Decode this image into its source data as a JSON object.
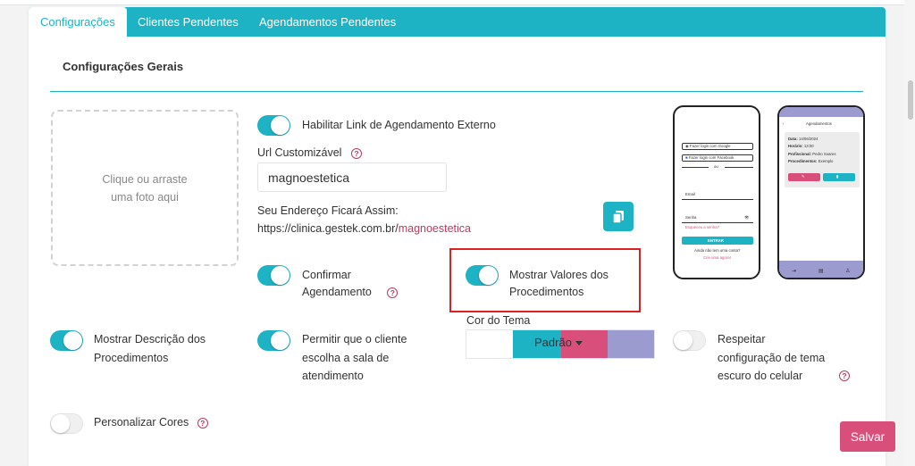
{
  "tabs": [
    {
      "label": "Configurações",
      "active": true
    },
    {
      "label": "Clientes Pendentes",
      "active": false
    },
    {
      "label": "Agendamentos Pendentes",
      "active": false
    }
  ],
  "section": {
    "title": "Configurações Gerais"
  },
  "dropzone": {
    "line1": "Clique ou arraste",
    "line2": "uma foto aqui"
  },
  "settings": {
    "external_link": {
      "label": "Habilitar Link de Agendamento Externo",
      "on": true
    },
    "custom_url": {
      "label": "Url Customizável",
      "value": "magnoestetica"
    },
    "address": {
      "label": "Seu Endereço Ficará Assim:",
      "base": "https://clinica.gestek.com.br/",
      "slug": "magnoestetica"
    },
    "confirm": {
      "line1": "Confirmar",
      "line2": "Agendamento",
      "on": true
    },
    "show_values": {
      "line1": "Mostrar Valores dos",
      "line2": "Procedimentos",
      "on": true
    },
    "show_description": {
      "line1": "Mostrar Descrição dos",
      "line2": "Procedimentos",
      "on": true
    },
    "choose_room": {
      "line1": "Permitir que o cliente",
      "line2": "escolha a sala de",
      "line3": "atendimento",
      "on": true
    },
    "dark_mode": {
      "line1": "Respeitar",
      "line2": "configuração de tema",
      "line3": "escuro do celular",
      "on": false
    },
    "custom_colors": {
      "label": "Personalizar Cores",
      "on": false
    }
  },
  "theme": {
    "label": "Cor do Tema",
    "selected": "Padrão",
    "swatches": [
      "#ffffff",
      "#1eb2c5",
      "#d94f7c",
      "#9b9bcf"
    ]
  },
  "actions": {
    "save": "Salvar"
  },
  "preview": {
    "login": {
      "google": "Fazer login com Google",
      "facebook": "Fazer login com Facebook",
      "or": "ou",
      "email": "Email",
      "password": "Senha",
      "forgot": "Esqueceu a senha?",
      "submit": "ENTRAR",
      "no_account": "Ainda não tem uma conta?",
      "create": "Crie uma agora!"
    },
    "appointment": {
      "title": "Agendamentos",
      "date_label": "Data:",
      "date": "14/06/2024",
      "time_label": "Horário:",
      "time": "13:00",
      "pro_label": "Profissional:",
      "pro": "Pedro Soares",
      "proc_label": "Procedimentos:",
      "proc": "Exemplo"
    }
  },
  "colors": {
    "accent": "#1eb2c5",
    "pink": "#d94f7c",
    "lavender": "#9b9bcf",
    "highlight": "#e02020"
  }
}
